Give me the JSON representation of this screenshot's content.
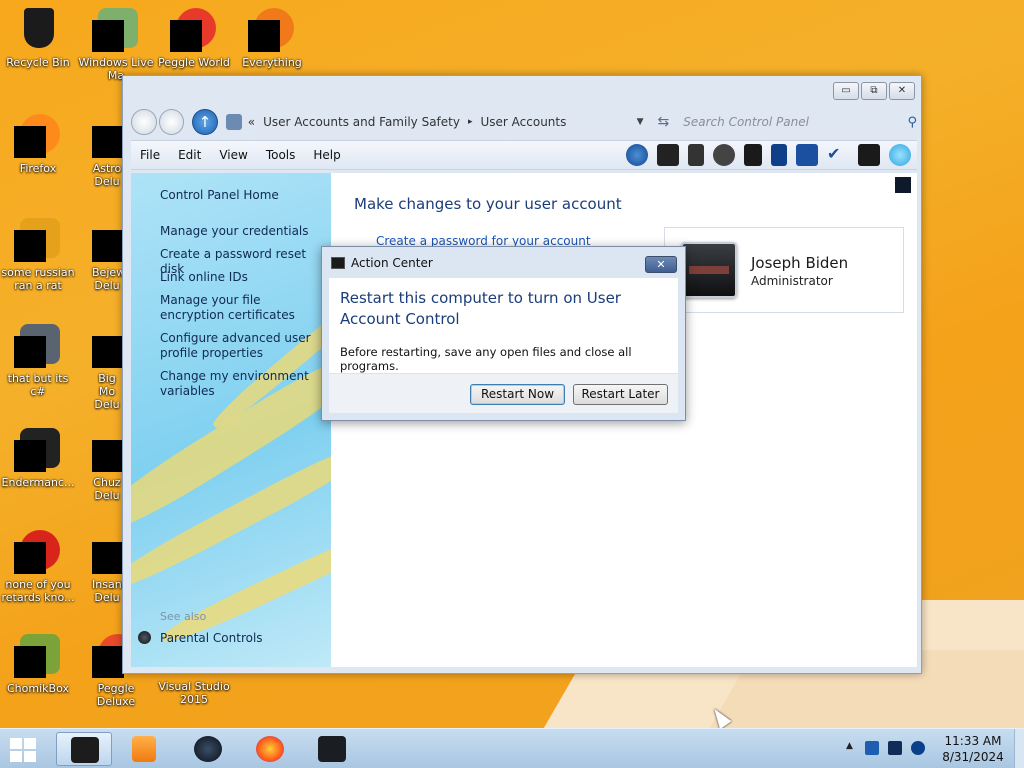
{
  "desktop": {
    "icons": [
      {
        "label": "Recycle Bin"
      },
      {
        "label": "Windows Live Ma"
      },
      {
        "label": "Peggle World"
      },
      {
        "label": "Everything"
      },
      {
        "label": "Firefox"
      },
      {
        "label": "Astro Delu"
      },
      {
        "label": "some russian ran a rat"
      },
      {
        "label": "Bejew Delu"
      },
      {
        "label": "that but its c#"
      },
      {
        "label": "Big Mo Delu"
      },
      {
        "label": "Endermanc..."
      },
      {
        "label": "Chuz Delu"
      },
      {
        "label": "none of you retards kno..."
      },
      {
        "label": "Insaniq Delu"
      },
      {
        "label": "ChomikBox"
      },
      {
        "label": "Peggle Deluxe"
      },
      {
        "label": "Visual Studio 2015"
      }
    ]
  },
  "window": {
    "caption_buttons": {
      "minimize": "▭",
      "maximize": "⧉",
      "close": "✕"
    },
    "address": {
      "crumb_prefix": "«",
      "crumbs": [
        "User Accounts and Family Safety",
        "User Accounts"
      ],
      "crumb_sep": "▸"
    },
    "search": {
      "placeholder": "Search Control Panel"
    },
    "menu": [
      "File",
      "Edit",
      "View",
      "Tools",
      "Help"
    ],
    "left_pane": {
      "home": "Control Panel Home",
      "links": [
        "Manage your credentials",
        "Create a password reset disk",
        "Link online IDs",
        "Manage your file encryption certificates",
        "Configure advanced user profile properties",
        "Change my environment variables"
      ],
      "see_also": "See also",
      "parental": "Parental Controls"
    },
    "main": {
      "title": "Make changes to your user account",
      "create_password": "Create a password for your account",
      "user": {
        "name": "Joseph Biden",
        "role": "Administrator"
      }
    }
  },
  "dialog": {
    "title": "Action Center",
    "close": "✕",
    "heading": "Restart this computer to turn on User Account Control",
    "message": "Before restarting, save any open files and close all programs.",
    "restart_now": "Restart Now",
    "restart_later": "Restart Later"
  },
  "taskbar": {
    "time": "11:33 AM",
    "date": "8/31/2024",
    "tray_overflow": "▲"
  },
  "colors": {
    "desktop_orange": "#f5a623",
    "link_blue": "#1a56b8",
    "title_blue": "#1b3d7a"
  }
}
